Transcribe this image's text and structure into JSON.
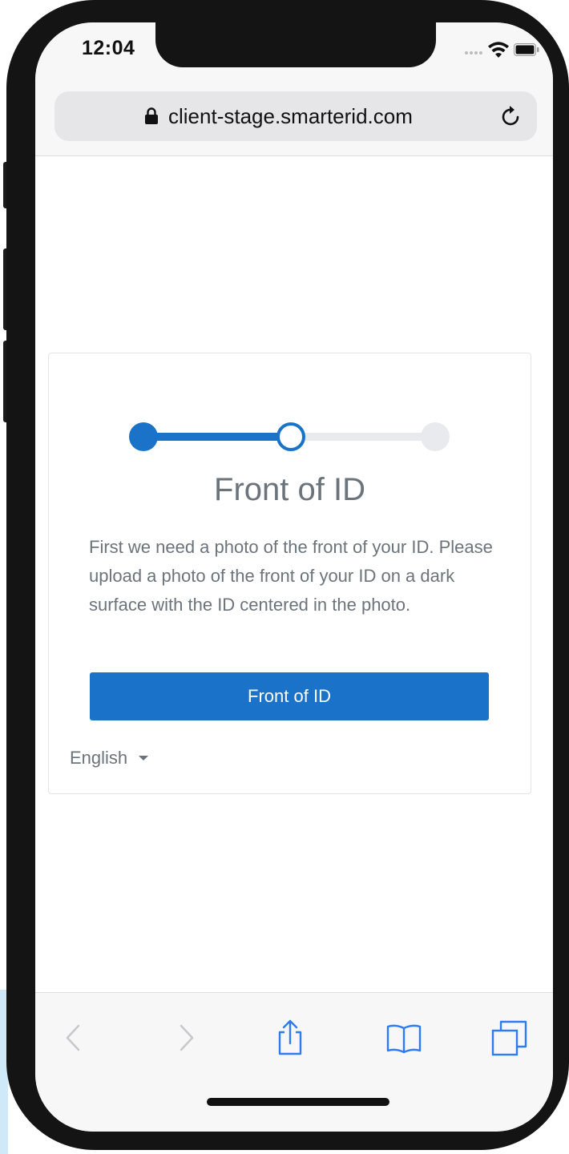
{
  "status_bar": {
    "time": "12:04"
  },
  "browser": {
    "url": "client-stage.smarterid.com"
  },
  "stepper": {
    "total_steps": 3,
    "current_step": 2
  },
  "card": {
    "title": "Front of ID",
    "description": "First we need a photo of the front of your ID. Please upload a photo of the front of your ID on a dark surface with the ID centered in the photo.",
    "button_label": "Front of ID",
    "language": "English"
  },
  "colors": {
    "accent": "#1a73c9",
    "text_muted": "#6b737b",
    "toolbar_icon": "#2d7bf6",
    "toolbar_icon_disabled": "#c7c7cc"
  },
  "toolbar": {
    "icons": [
      "back-icon",
      "forward-icon",
      "share-icon",
      "bookmarks-icon",
      "tabs-icon"
    ]
  }
}
